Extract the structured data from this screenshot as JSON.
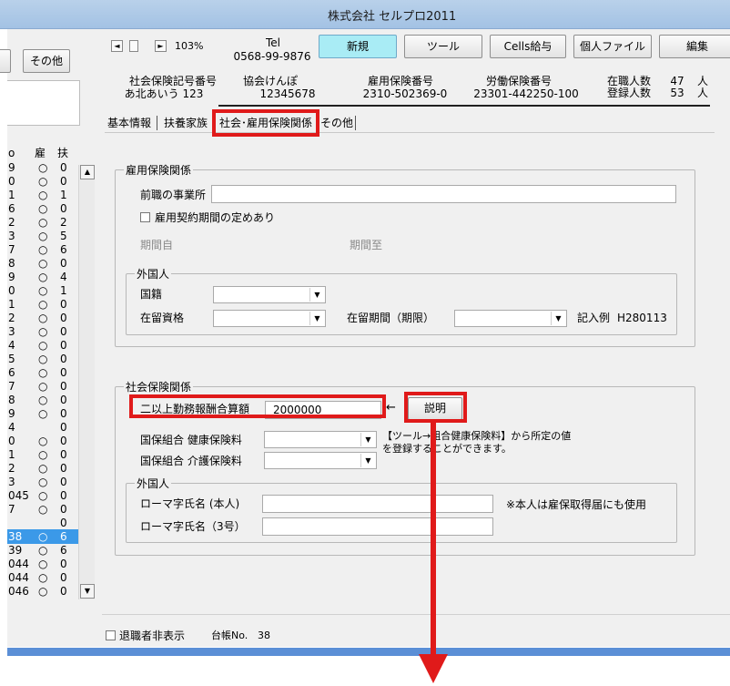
{
  "window": {
    "title": "株式会社 セルプロ2011"
  },
  "toolbar": {
    "nav_prev": "◄",
    "nav_mid": "",
    "nav_next": "►",
    "zoom": "103%",
    "tel_label": "Tel",
    "tel_number": "0568-99-9876",
    "new_label": "新規",
    "tools_label": "ツール",
    "cells_label": "Cells給与",
    "personal_file_label": "個人ファイル",
    "edit_label": "編集"
  },
  "left_panel": {
    "other_button": "その他"
  },
  "header_info": {
    "social_insurance_symbol_label": "社会保険記号番号",
    "social_insurance_symbol_value": "あ北あいう 123",
    "kyokai_label": "協会けんぽ",
    "kyokai_value": "12345678",
    "employment_insurance_label": "雇用保険番号",
    "employment_insurance_value": "2310-502369-0",
    "labor_insurance_label": "労働保険番号",
    "labor_insurance_value": "23301-442250-100",
    "employed_label": "在職人数",
    "employed_count": "47",
    "registered_label": "登録人数",
    "registered_count": "53",
    "person_unit": "人"
  },
  "tabs": [
    {
      "label": "基本情報"
    },
    {
      "label": "扶養家族"
    },
    {
      "label": "社会･雇用保険関係"
    },
    {
      "label": "その他"
    }
  ],
  "list": {
    "headers": [
      "o",
      "雇",
      "扶"
    ],
    "rows": [
      [
        "9",
        "○",
        "0"
      ],
      [
        "0",
        "○",
        "0"
      ],
      [
        "1",
        "○",
        "1"
      ],
      [
        "6",
        "○",
        "0"
      ],
      [
        "2",
        "○",
        "2"
      ],
      [
        "3",
        "○",
        "5"
      ],
      [
        "7",
        "○",
        "6"
      ],
      [
        "8",
        "○",
        "0"
      ],
      [
        "9",
        "○",
        "4"
      ],
      [
        "0",
        "○",
        "1"
      ],
      [
        "1",
        "○",
        "0"
      ],
      [
        "2",
        "○",
        "0"
      ],
      [
        "3",
        "○",
        "0"
      ],
      [
        "4",
        "○",
        "0"
      ],
      [
        "5",
        "○",
        "0"
      ],
      [
        "6",
        "○",
        "0"
      ],
      [
        "7",
        "○",
        "0"
      ],
      [
        "8",
        "○",
        "0"
      ],
      [
        "9",
        "○",
        "0"
      ],
      [
        "4",
        "",
        "0"
      ],
      [
        "0",
        "○",
        "0"
      ],
      [
        "1",
        "○",
        "0"
      ],
      [
        "2",
        "○",
        "0"
      ],
      [
        "3",
        "○",
        "0"
      ],
      [
        "045",
        "○",
        "0"
      ],
      [
        "7",
        "○",
        "0"
      ],
      [
        "",
        "",
        "0"
      ],
      [
        "38",
        "○",
        "6"
      ],
      [
        "39",
        "○",
        "6"
      ],
      [
        "044",
        "○",
        "0"
      ],
      [
        "044",
        "○",
        "0"
      ],
      [
        "046",
        "○",
        "0"
      ]
    ],
    "selected_index": 27
  },
  "employment_section": {
    "title": "雇用保険関係",
    "previous_employer_label": "前職の事業所",
    "previous_employer_value": "",
    "contract_period_label": "雇用契約期間の定めあり",
    "period_from_label": "期間自",
    "period_to_label": "期間至",
    "foreigner_title": "外国人",
    "nationality_label": "国籍",
    "status_label": "在留資格",
    "stay_period_label": "在留期間（期限）",
    "example_label": "記入例",
    "example_value": "H280113"
  },
  "social_section": {
    "title": "社会保険関係",
    "dual_employment_label": "二以上勤務報酬合算額",
    "dual_employment_value": "2000000",
    "arrow": "←",
    "explain_button": "説明",
    "health_union_label": "国保組合 健康保険料",
    "care_union_label": "国保組合 介護保険料",
    "note_line1": "【ツール→組合健康保険料】から所定の値",
    "note_line2": "を登録することができます。",
    "foreigner_title": "外国人",
    "roman_name_label": "ローマ字氏名 (本人)",
    "roman_name_3_label": "ローマ字氏名（3号）",
    "roman_note": "※本人は雇保取得届にも使用"
  },
  "footer": {
    "retired_hide_label": "退職者非表示",
    "ledger_label": "台帳No.",
    "ledger_value": "38"
  },
  "colors": {
    "highlight_red": "#e01a1a",
    "selected_row": "#3b99e8",
    "new_button": "#a9ecf5",
    "title_bar": "#b9d1ea",
    "bottom_bar": "#5b8fd6"
  }
}
